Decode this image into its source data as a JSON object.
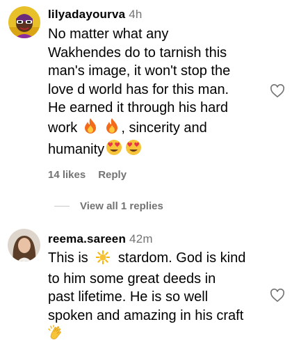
{
  "comments": [
    {
      "username": "lilyadayourva",
      "time": "4h",
      "lines": [
        "No matter what any",
        "Wakhendes do to tarnish this",
        "man's image, it won't stop the",
        "love d world has for this man.",
        "He earned it through his hard"
      ],
      "line6_a": "work",
      "line6_b": ", sincerity and",
      "line7": "humanity",
      "likes": "14 likes",
      "reply": "Reply",
      "view_replies": "View all 1 replies",
      "icons": [
        "fire-emoji",
        "fire-emoji",
        "heart-eyes-emoji",
        "heart-eyes-emoji",
        "heart-outline-icon"
      ]
    },
    {
      "username": "reema.sareen",
      "time": "42m",
      "line1_a": "This is",
      "line1_b": "stardom. God is kind",
      "lines": [
        "to him some great deeds in",
        "past lifetime. He is so well",
        "spoken and amazing in his craft"
      ],
      "icons": [
        "sun-emoji",
        "clapping-hands-emoji",
        "heart-outline-icon"
      ]
    }
  ],
  "colors": {
    "secondary_text": "#737373",
    "divider": "#c7c7c7"
  }
}
